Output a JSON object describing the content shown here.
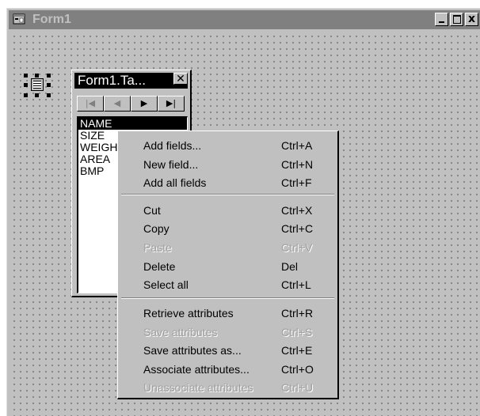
{
  "window": {
    "title": "Form1",
    "close_glyph": "x"
  },
  "component": {
    "icon": "table-icon"
  },
  "fields_editor": {
    "title": "Form1.Ta...",
    "close_glyph": "✕",
    "nav_buttons": [
      "|◀",
      "◀",
      "▶",
      "▶|"
    ],
    "fields": [
      "NAME",
      "SIZE",
      "WEIGHT",
      "AREA",
      "BMP"
    ]
  },
  "context_menu": {
    "items": [
      {
        "label": "Add fields...",
        "shortcut": "Ctrl+A"
      },
      {
        "label": "New field...",
        "shortcut": "Ctrl+N"
      },
      {
        "label": "Add all fields",
        "shortcut": "Ctrl+F"
      },
      {
        "label": "Cut",
        "shortcut": "Ctrl+X"
      },
      {
        "label": "Copy",
        "shortcut": "Ctrl+C"
      },
      {
        "label": "Paste",
        "shortcut": "Ctrl+V"
      },
      {
        "label": "Delete",
        "shortcut": "Del"
      },
      {
        "label": "Select all",
        "shortcut": "Ctrl+L"
      },
      {
        "label": "Retrieve attributes",
        "shortcut": "Ctrl+R"
      },
      {
        "label": "Save attributes",
        "shortcut": "Ctrl+S"
      },
      {
        "label": "Save attributes as...",
        "shortcut": "Ctrl+E"
      },
      {
        "label": "Associate attributes...",
        "shortcut": "Ctrl+O"
      },
      {
        "label": "Unassociate attributes",
        "shortcut": "Ctrl+U"
      }
    ]
  },
  "colors": {
    "face": "#c0c0c0",
    "inactive_title": "#808080",
    "active_title": "#000000",
    "disabled_text": "#a0a0a0"
  }
}
